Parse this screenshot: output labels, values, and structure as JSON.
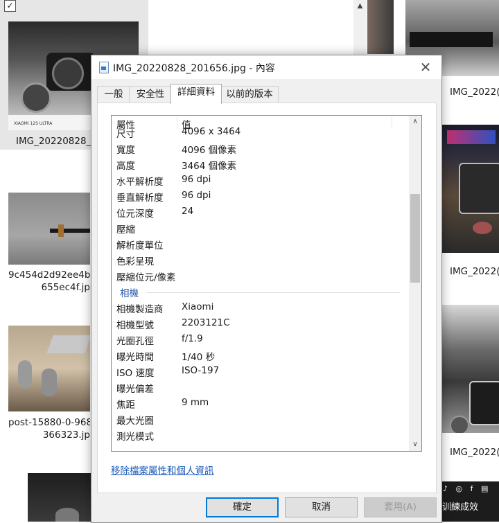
{
  "explorer": {
    "left_files": [
      {
        "label_line1": "IMG_20220828_2",
        "label_line2": ""
      },
      {
        "label_line1": "9c454d2d92ee4b3",
        "label_line2": "655ec4f.jp"
      },
      {
        "label_line1": "post-15880-0-968",
        "label_line2": "366323.jp"
      }
    ],
    "right_files": [
      {
        "label": "IMG_2022("
      },
      {
        "label": "IMG_2022("
      },
      {
        "label": "IMG_2022("
      }
    ],
    "thumb_caption": "XIAOMI 12S ULTRA",
    "toast_text": "训練成效"
  },
  "dialog": {
    "title": "IMG_20220828_201656.jpg - 內容",
    "tabs": [
      {
        "label": "一般"
      },
      {
        "label": "安全性"
      },
      {
        "label": "詳細資料"
      },
      {
        "label": "以前的版本"
      }
    ],
    "columns": {
      "property": "屬性",
      "value": "值"
    },
    "rows_a": [
      {
        "k": "尺寸",
        "v": "4096 x 3464"
      },
      {
        "k": "寬度",
        "v": "4096 個像素"
      },
      {
        "k": "高度",
        "v": "3464 個像素"
      },
      {
        "k": "水平解析度",
        "v": "96 dpi"
      },
      {
        "k": "垂直解析度",
        "v": "96 dpi"
      },
      {
        "k": "位元深度",
        "v": "24"
      },
      {
        "k": "壓縮",
        "v": ""
      },
      {
        "k": "解析度單位",
        "v": ""
      },
      {
        "k": "色彩呈現",
        "v": ""
      },
      {
        "k": "壓縮位元/像素",
        "v": ""
      }
    ],
    "group_camera": "相機",
    "rows_b": [
      {
        "k": "相機製造商",
        "v": "Xiaomi"
      },
      {
        "k": "相機型號",
        "v": "2203121C"
      },
      {
        "k": "光圈孔徑",
        "v": "f/1.9"
      },
      {
        "k": "曝光時間",
        "v": "1/40 秒"
      },
      {
        "k": "ISO 速度",
        "v": "ISO-197"
      },
      {
        "k": "曝光偏差",
        "v": ""
      },
      {
        "k": "焦距",
        "v": "9 mm"
      },
      {
        "k": "最大光圈",
        "v": ""
      },
      {
        "k": "測光模式",
        "v": ""
      }
    ],
    "remove_link": "移除檔案屬性和個人資訊",
    "buttons": {
      "ok": "確定",
      "cancel": "取消",
      "apply": "套用(A)"
    }
  }
}
